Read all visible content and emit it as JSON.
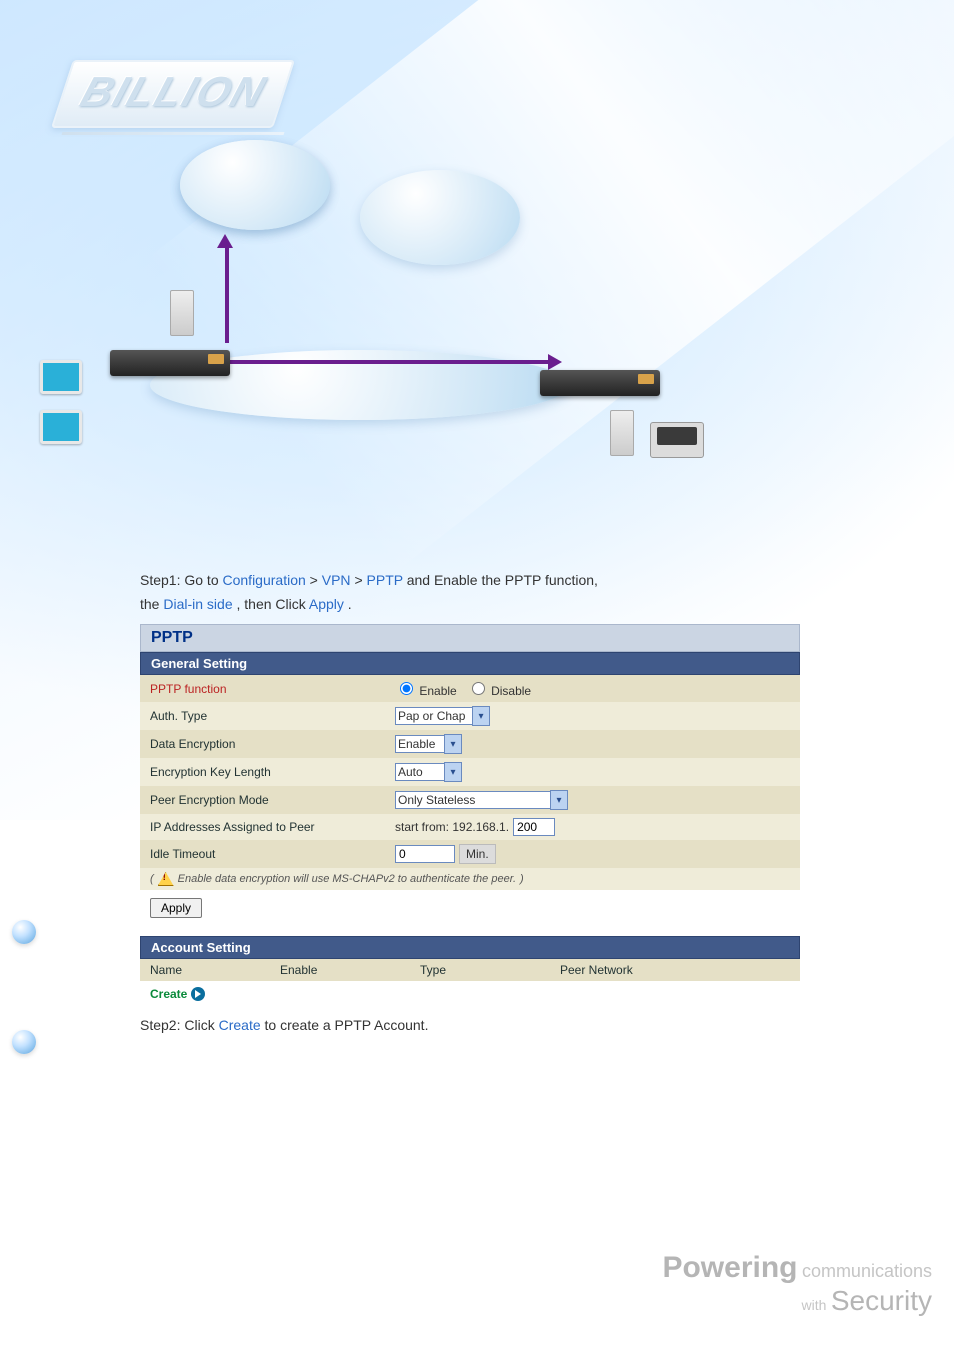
{
  "brand": "BILLION",
  "step1": {
    "prefix": "Step1: Go to ",
    "path1": "Configuration",
    "sep": " > ",
    "path2": "VPN",
    "path3": "PPTP",
    "mid": " and Enable the PPTP function, ",
    "line2a": "the ",
    "dial": "Dial-in side",
    "line2b": ", then Click ",
    "apply": "Apply",
    "dot": "."
  },
  "panel": {
    "title": "PPTP",
    "general": "General Setting",
    "rows": {
      "pptp_fn": {
        "label": "PPTP function",
        "enable": "Enable",
        "disable": "Disable"
      },
      "auth": {
        "label": "Auth. Type",
        "value": "Pap or Chap"
      },
      "enc": {
        "label": "Data Encryption",
        "value": "Enable"
      },
      "keylen": {
        "label": "Encryption Key Length",
        "value": "Auto"
      },
      "peermode": {
        "label": "Peer Encryption Mode",
        "value": "Only Stateless"
      },
      "ipassign": {
        "label": "IP Addresses Assigned to Peer",
        "prefix": "start from: 192.168.1.",
        "value": "200"
      },
      "idle": {
        "label": "Idle Timeout",
        "value": "0",
        "unit": "Min."
      }
    },
    "note": "Enable data encryption will use MS-CHAPv2 to authenticate the peer.",
    "apply_btn": "Apply"
  },
  "account": {
    "title": "Account Setting",
    "cols": {
      "name": "Name",
      "enable": "Enable",
      "type": "Type",
      "peer": "Peer Network"
    },
    "create": "Create"
  },
  "step2": {
    "prefix": "Step2: Click ",
    "link": "Create",
    "suffix": " to create a PPTP Account."
  },
  "slogan": {
    "p1": "Powering",
    "p2": "communications",
    "p3": "with",
    "p4": "Security"
  }
}
